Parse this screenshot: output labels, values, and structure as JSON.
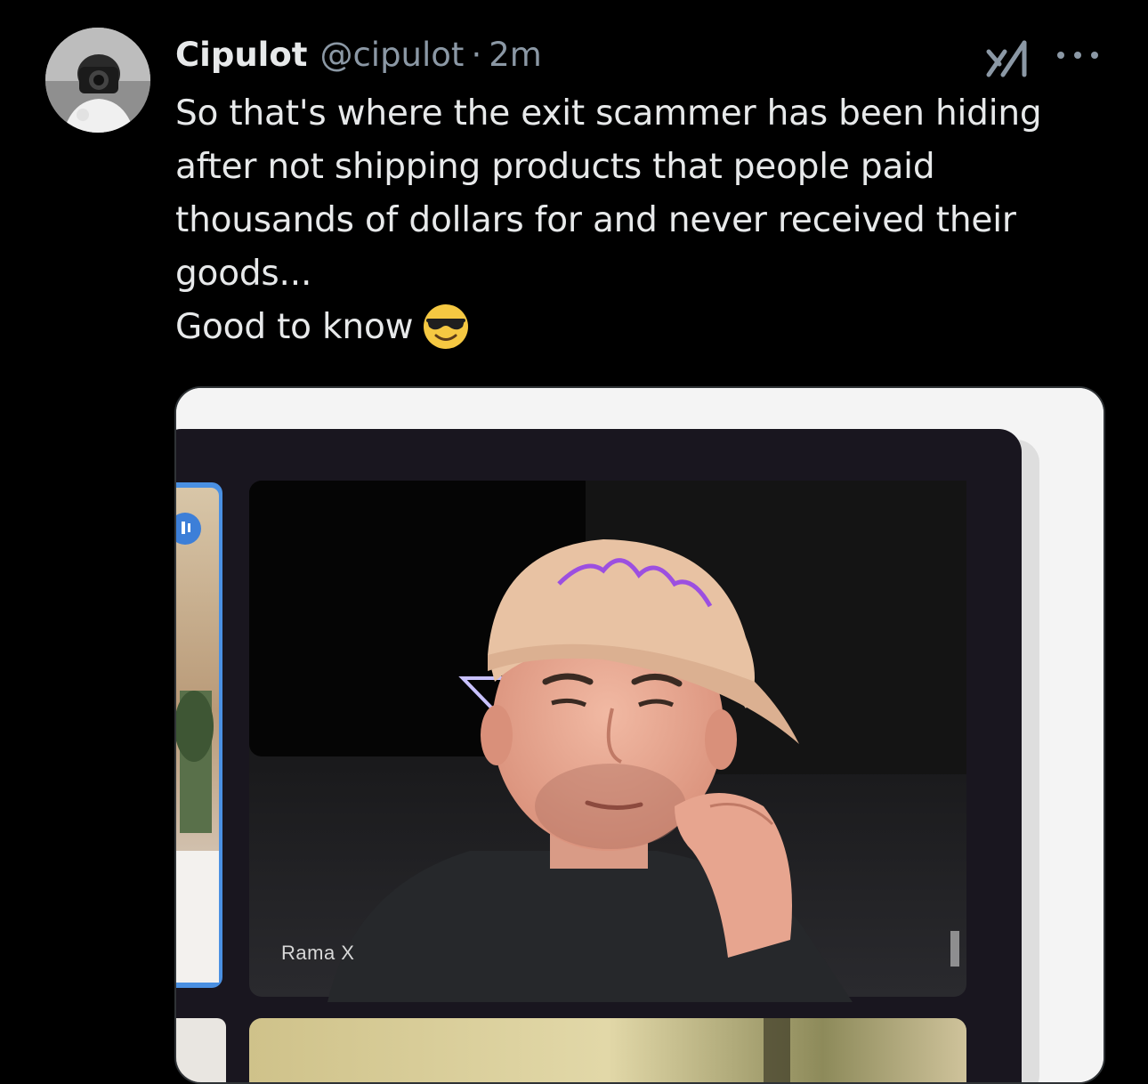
{
  "post": {
    "author": {
      "display_name": "Cipulot",
      "handle": "@cipulot",
      "separator": "·",
      "timestamp": "2m",
      "avatar_icon": "camera-selfie-avatar"
    },
    "actions": {
      "grok_icon": "grok-icon",
      "more_icon": "more-options-icon"
    },
    "text_lines": [
      "So that's where the exit scammer has been hiding after not shipping products that people paid thousands of dollars for and never received their goods...",
      "Good to know"
    ],
    "emoji": "smiling-face-with-sunglasses",
    "media": {
      "type": "video-call-screenshot",
      "participant_label": "Rama X"
    }
  },
  "colors": {
    "background": "#000000",
    "primary_text": "#e7e9ea",
    "secondary_text": "#8b98a5",
    "call_frame_border": "#4a90e2"
  }
}
